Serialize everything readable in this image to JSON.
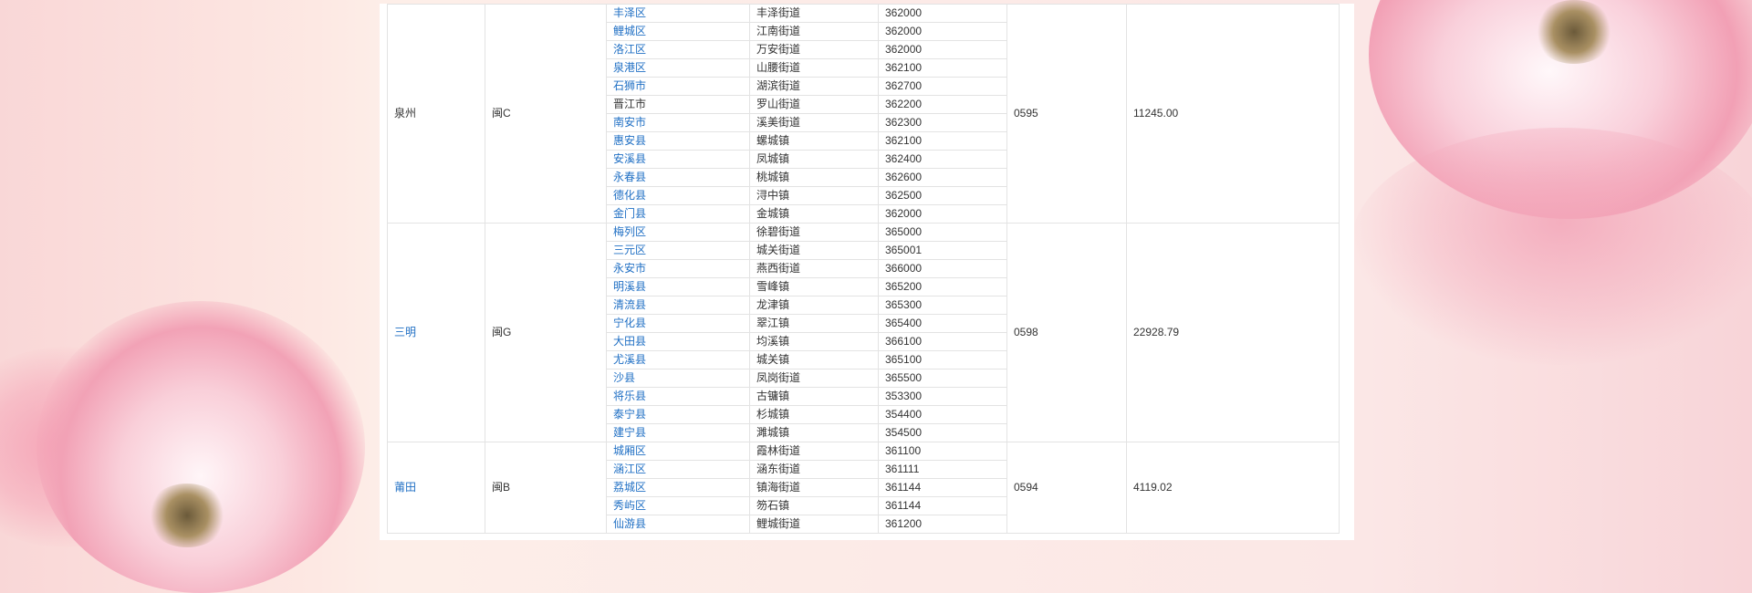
{
  "page": {
    "accent_color": "#1f6fc4"
  },
  "groups": [
    {
      "city": "泉州",
      "city_link": false,
      "plate": "闽C",
      "area_code": "0595",
      "area": "11245.00",
      "districts": [
        {
          "name": "丰泽区",
          "street": "丰泽街道",
          "postcode": "362000"
        },
        {
          "name": "鲤城区",
          "street": "江南街道",
          "postcode": "362000"
        },
        {
          "name": "洛江区",
          "street": "万安街道",
          "postcode": "362000"
        },
        {
          "name": "泉港区",
          "street": "山腰街道",
          "postcode": "362100"
        },
        {
          "name": "石狮市",
          "street": "湖滨街道",
          "postcode": "362700"
        },
        {
          "name": "晋江市",
          "street": "罗山街道",
          "postcode": "362200",
          "plain": true
        },
        {
          "name": "南安市",
          "street": "溪美街道",
          "postcode": "362300"
        },
        {
          "name": "惠安县",
          "street": "螺城镇",
          "postcode": "362100"
        },
        {
          "name": "安溪县",
          "street": "凤城镇",
          "postcode": "362400"
        },
        {
          "name": "永春县",
          "street": "桃城镇",
          "postcode": "362600"
        },
        {
          "name": "德化县",
          "street": "浔中镇",
          "postcode": "362500"
        },
        {
          "name": "金门县",
          "street": "金城镇",
          "postcode": "362000"
        }
      ]
    },
    {
      "city": "三明",
      "city_link": true,
      "plate": "闽G",
      "area_code": "0598",
      "area": "22928.79",
      "districts": [
        {
          "name": "梅列区",
          "street": "徐碧街道",
          "postcode": "365000"
        },
        {
          "name": "三元区",
          "street": "城关街道",
          "postcode": "365001"
        },
        {
          "name": "永安市",
          "street": "燕西街道",
          "postcode": "366000"
        },
        {
          "name": "明溪县",
          "street": "雪峰镇",
          "postcode": "365200"
        },
        {
          "name": "清流县",
          "street": "龙津镇",
          "postcode": "365300"
        },
        {
          "name": "宁化县",
          "street": "翠江镇",
          "postcode": "365400"
        },
        {
          "name": "大田县",
          "street": "均溪镇",
          "postcode": "366100"
        },
        {
          "name": "尤溪县",
          "street": "城关镇",
          "postcode": "365100"
        },
        {
          "name": "沙县",
          "street": "凤岗街道",
          "postcode": "365500"
        },
        {
          "name": "将乐县",
          "street": "古镛镇",
          "postcode": "353300"
        },
        {
          "name": "泰宁县",
          "street": "杉城镇",
          "postcode": "354400"
        },
        {
          "name": "建宁县",
          "street": "濉城镇",
          "postcode": "354500"
        }
      ]
    },
    {
      "city": "莆田",
      "city_link": true,
      "plate": "闽B",
      "area_code": "0594",
      "area": "4119.02",
      "districts": [
        {
          "name": "城厢区",
          "street": "霞林街道",
          "postcode": "361100"
        },
        {
          "name": "涵江区",
          "street": "涵东街道",
          "postcode": "361111"
        },
        {
          "name": "荔城区",
          "street": "镇海街道",
          "postcode": "361144"
        },
        {
          "name": "秀屿区",
          "street": "笏石镇",
          "postcode": "361144"
        },
        {
          "name": "仙游县",
          "street": "鲤城街道",
          "postcode": "361200"
        }
      ]
    }
  ]
}
